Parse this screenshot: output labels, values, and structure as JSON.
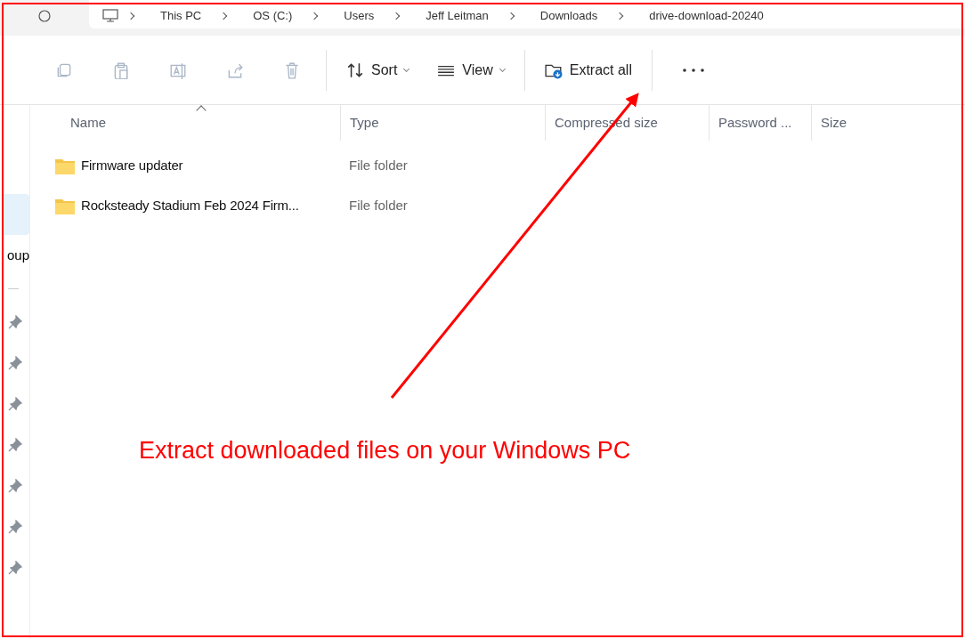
{
  "breadcrumb": [
    "This PC",
    "OS (C:)",
    "Users",
    "Jeff Leitman",
    "Downloads",
    "drive-download-20240"
  ],
  "toolbar": [
    {
      "kind": "copy",
      "disabled": true
    },
    {
      "kind": "paste",
      "disabled": true
    },
    {
      "kind": "rename",
      "disabled": true
    },
    {
      "kind": "share",
      "disabled": true
    },
    {
      "kind": "delete",
      "disabled": true
    },
    {
      "kind": "sort",
      "label": "Sort",
      "disabled": false
    },
    {
      "kind": "view",
      "label": "View",
      "disabled": false
    },
    {
      "kind": "extract",
      "label": "Extract all",
      "disabled": false
    },
    {
      "kind": "more",
      "disabled": false
    }
  ],
  "sidebar": {
    "items": [
      {
        "selected": true
      },
      {
        "label": "oup",
        "selected": false
      },
      {
        "selected": false,
        "pinned": true
      },
      {
        "selected": false,
        "pinned": true
      },
      {
        "selected": false,
        "pinned": true
      },
      {
        "selected": false,
        "pinned": true
      },
      {
        "selected": false,
        "pinned": true
      },
      {
        "selected": false,
        "pinned": true
      },
      {
        "selected": false,
        "pinned": true
      }
    ]
  },
  "table": {
    "columns": [
      {
        "label": "Name",
        "sorted": true
      },
      {
        "label": "Type",
        "sorted": false
      },
      {
        "label": "Compressed size",
        "sorted": false
      },
      {
        "label": "Password ...",
        "sorted": false
      },
      {
        "label": "Size",
        "sorted": false
      }
    ],
    "rows": [
      {
        "name": "Firmware updater",
        "type": "File folder"
      },
      {
        "name": "Rocksteady Stadium Feb 2024 Firm...",
        "type": "File folder"
      }
    ]
  },
  "annotation": {
    "caption": "Extract downloaded files on your Windows PC"
  }
}
